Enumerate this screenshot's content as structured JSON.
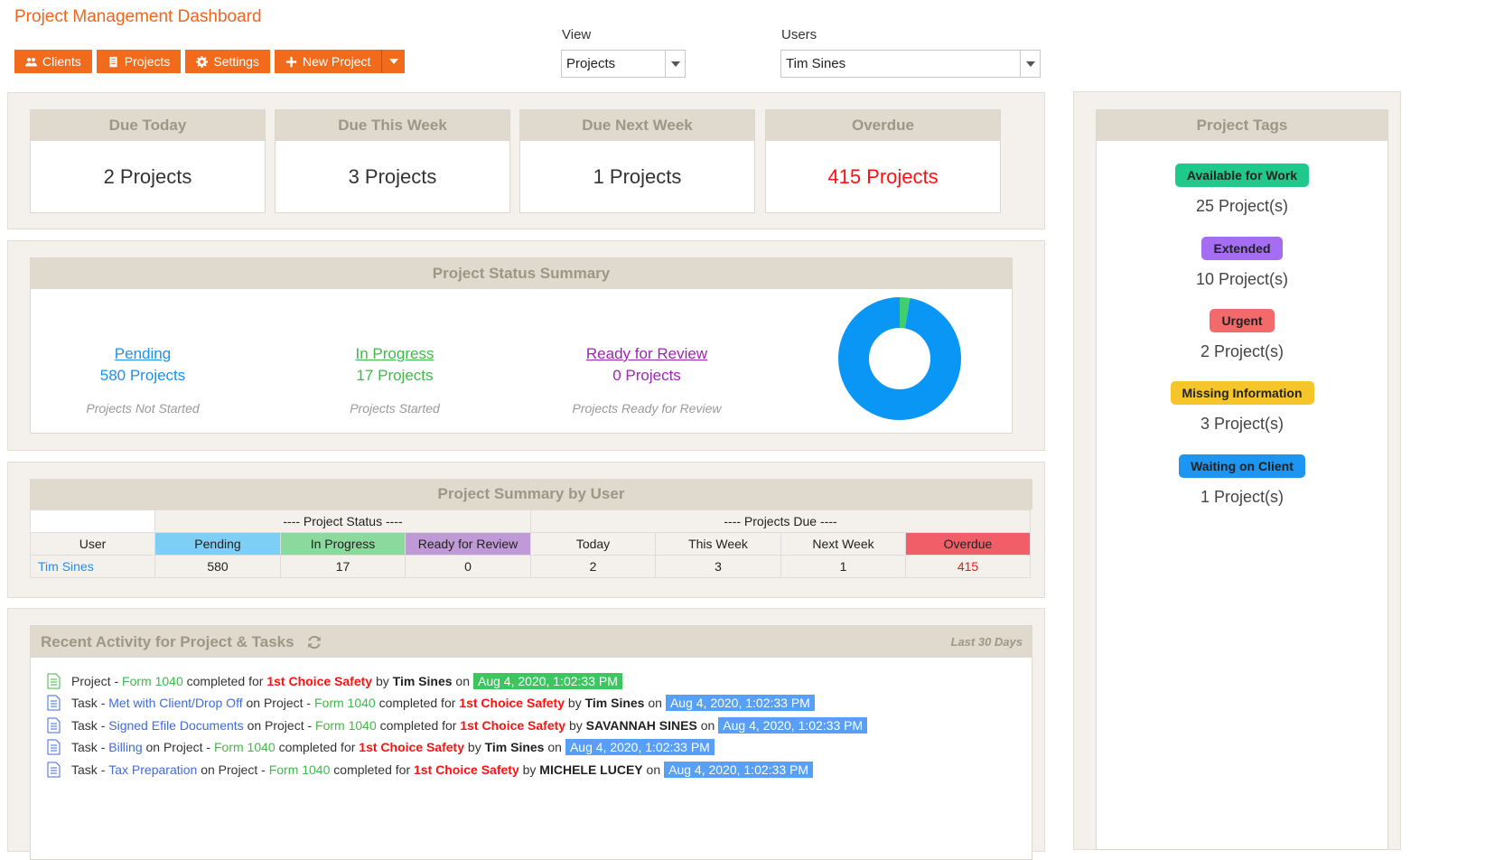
{
  "page_title": "Project Management Dashboard",
  "toolbar": {
    "clients_label": "Clients",
    "projects_label": "Projects",
    "settings_label": "Settings",
    "new_project_label": "New Project"
  },
  "view": {
    "label": "View",
    "value": "Projects"
  },
  "users": {
    "label": "Users",
    "value": "Tim Sines"
  },
  "due": {
    "today": {
      "title": "Due Today",
      "value": "2 Projects"
    },
    "this_week": {
      "title": "Due This Week",
      "value": "3 Projects"
    },
    "next_week": {
      "title": "Due Next Week",
      "value": "1 Projects"
    },
    "overdue": {
      "title": "Overdue",
      "value": "415 Projects"
    }
  },
  "status_summary": {
    "title": "Project Status Summary",
    "pending": {
      "link": "Pending",
      "count": "580 Projects",
      "sub": "Projects Not Started",
      "color": "#1e90f0"
    },
    "in_progress": {
      "link": "In Progress",
      "count": "17 Projects",
      "sub": "Projects Started",
      "color": "#3fb94a"
    },
    "review": {
      "link": "Ready for Review",
      "count": "0 Projects",
      "sub": "Projects Ready for Review",
      "color": "#9b27b0"
    },
    "donut": {
      "pending": 580,
      "in_progress": 17,
      "review": 0
    }
  },
  "user_summary": {
    "title": "Project Summary by User",
    "group_status": "---- Project Status ----",
    "group_due": "---- Projects Due ----",
    "columns": [
      "User",
      "Pending",
      "In Progress",
      "Ready for Review",
      "Today",
      "This Week",
      "Next Week",
      "Overdue"
    ],
    "rows": [
      {
        "user": "Tim Sines",
        "pending": "580",
        "in_progress": "17",
        "review": "0",
        "today": "2",
        "this_week": "3",
        "next_week": "1",
        "overdue": "415"
      }
    ]
  },
  "activity": {
    "title": "Recent Activity for Project & Tasks",
    "range": "Last 30 Days",
    "items": [
      {
        "type": "Project",
        "project": "Form 1040",
        "verb": "completed for",
        "client": "1st Choice Safety",
        "by": "Tim Sines",
        "ts": "Aug 4, 2020, 1:02:33 PM"
      },
      {
        "type": "Task",
        "task": "Met with Client/Drop Off",
        "project": "Form 1040",
        "verb": "completed for",
        "client": "1st Choice Safety",
        "by": "Tim Sines",
        "ts": "Aug 4, 2020, 1:02:33 PM"
      },
      {
        "type": "Task",
        "task": "Signed Efile Documents",
        "project": "Form 1040",
        "verb": "completed for",
        "client": "1st Choice Safety",
        "by": "SAVANNAH SINES",
        "ts": "Aug 4, 2020, 1:02:33 PM"
      },
      {
        "type": "Task",
        "task": "Billing",
        "project": "Form 1040",
        "verb": "completed for",
        "client": "1st Choice Safety",
        "by": "Tim Sines",
        "ts": "Aug 4, 2020, 1:02:33 PM"
      },
      {
        "type": "Task",
        "task": "Tax Preparation",
        "project": "Form 1040",
        "verb": "completed for",
        "client": "1st Choice Safety",
        "by": "MICHELE LUCEY",
        "ts": "Aug 4, 2020, 1:02:33 PM"
      }
    ],
    "words": {
      "by": "by",
      "on": "on",
      "on_project": "on Project -",
      "dash": "-"
    }
  },
  "tags": {
    "title": "Project Tags",
    "items": [
      {
        "name": "Available for Work",
        "count": "25 Project(s)",
        "color": "#1ec98b"
      },
      {
        "name": "Extended",
        "count": "10 Project(s)",
        "color": "#a56df2"
      },
      {
        "name": "Urgent",
        "count": "2 Project(s)",
        "color": "#f36a6a"
      },
      {
        "name": "Missing Information",
        "count": "3 Project(s)",
        "color": "#f6c52a"
      },
      {
        "name": "Waiting on Client",
        "count": "1 Project(s)",
        "color": "#1e95f0"
      }
    ]
  }
}
